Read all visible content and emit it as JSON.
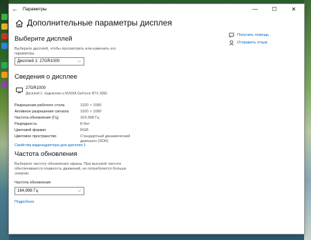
{
  "window": {
    "title": "Параметры",
    "back_glyph": "←",
    "min_glyph": "—",
    "max_glyph": "☐",
    "close_glyph": "✕"
  },
  "page": {
    "title": "Дополнительные параметры дисплея"
  },
  "select_display": {
    "heading": "Выберите дисплей",
    "description": "Выберите дисплей, чтобы просмотреть или изменить его параметры.",
    "dropdown_value": "Дисплей 1: 27GR1000"
  },
  "display_info": {
    "heading": "Сведения о дисплее",
    "monitor_name": "27GR1000",
    "monitor_sub": "Дисплей 1: подключен к NVIDIA GeForce RTX 3060",
    "rows": [
      {
        "label": "Разрешение рабочего стола",
        "value": "1920 × 1080"
      },
      {
        "label": "Активное разрешение сигнала",
        "value": "1920 × 1080"
      },
      {
        "label": "Частота обновления (Гц)",
        "value": "164,998 Гц"
      },
      {
        "label": "Разрядность",
        "value": "8-бит"
      },
      {
        "label": "Цветовой формат",
        "value": "RGB"
      },
      {
        "label": "Цветовое пространство",
        "value": "Стандартный динамический диапазон (SDR)"
      }
    ],
    "adapter_link": "Свойства видеоадаптера для дисплея 1"
  },
  "refresh": {
    "heading": "Частота обновления",
    "description": "Выберите частоту обновления экрана. При высокой частоте обеспечивается плавность движений, но потребляется больше энергии.",
    "field_label": "Частота обновления",
    "dropdown_value": "164,998 Гц",
    "more_link": "Подробнее"
  },
  "aside": {
    "help": "Получить помощь",
    "feedback": "Отправить отзыв"
  },
  "colors": {
    "accent": "#0067c0"
  }
}
